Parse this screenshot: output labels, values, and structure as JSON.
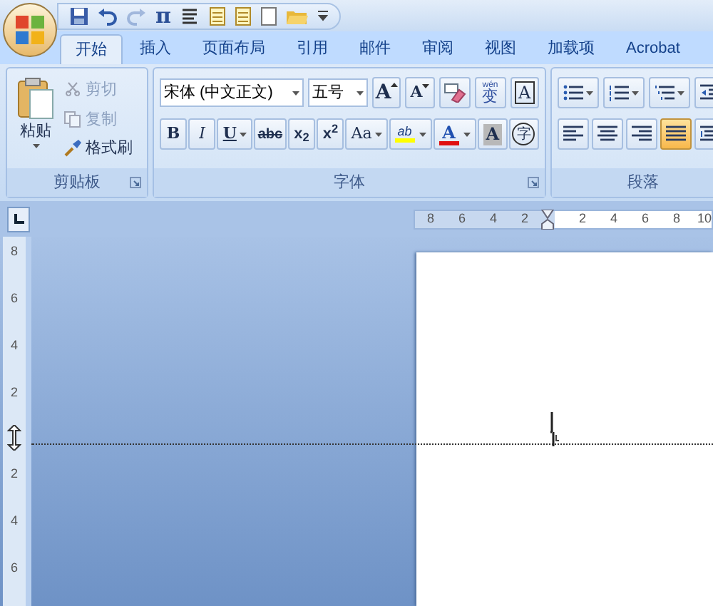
{
  "quick_access": [
    {
      "kind": "save",
      "disabled": false
    },
    {
      "kind": "undo",
      "disabled": false
    },
    {
      "kind": "redo",
      "disabled": true
    },
    {
      "kind": "equation",
      "label": "π",
      "disabled": false
    },
    {
      "kind": "list",
      "disabled": false
    },
    {
      "kind": "page",
      "disabled": false
    },
    {
      "kind": "page",
      "disabled": false
    },
    {
      "kind": "blank",
      "disabled": false
    },
    {
      "kind": "open",
      "disabled": false
    },
    {
      "kind": "customize",
      "disabled": false
    }
  ],
  "tabs": [
    {
      "label": "开始",
      "selected": true
    },
    {
      "label": "插入",
      "selected": false
    },
    {
      "label": "页面布局",
      "selected": false
    },
    {
      "label": "引用",
      "selected": false
    },
    {
      "label": "邮件",
      "selected": false
    },
    {
      "label": "审阅",
      "selected": false
    },
    {
      "label": "视图",
      "selected": false
    },
    {
      "label": "加载项",
      "selected": false
    },
    {
      "label": "Acrobat",
      "selected": false
    }
  ],
  "clipboard": {
    "title": "剪贴板",
    "paste": "粘贴",
    "items": [
      {
        "kind": "cut",
        "label": "剪切",
        "disabled": true
      },
      {
        "kind": "copy",
        "label": "复制",
        "disabled": true
      },
      {
        "kind": "painter",
        "label": "格式刷",
        "disabled": false
      }
    ]
  },
  "font": {
    "title": "字体",
    "font_name": "宋体 (中文正文)",
    "font_size": "五号",
    "row1": [
      {
        "kind": "grow",
        "label": "A"
      },
      {
        "kind": "shrink",
        "label": "A"
      },
      {
        "kind": "clear"
      },
      {
        "kind": "phonetic",
        "label": "变",
        "ruby": "wén"
      },
      {
        "kind": "border",
        "label": "A"
      }
    ],
    "row2": [
      {
        "kind": "bold",
        "label": "B"
      },
      {
        "kind": "italic",
        "label": "I"
      },
      {
        "kind": "underline",
        "label": "U"
      },
      {
        "kind": "strike",
        "label": "abc"
      },
      {
        "kind": "sub",
        "label": "x$_{2}$"
      },
      {
        "kind": "sup",
        "label": "x$^{2}$"
      },
      {
        "kind": "case",
        "label": "Aa"
      },
      {
        "kind": "highlight",
        "label": "ab",
        "color": "#ffff00"
      },
      {
        "kind": "fontcolor",
        "label": "A",
        "color": "#e01010"
      },
      {
        "kind": "shade",
        "label": "A"
      },
      {
        "kind": "enclose",
        "label": "字"
      }
    ]
  },
  "paragraph": {
    "title": "段落",
    "row1": [
      {
        "kind": "bullets"
      },
      {
        "kind": "numbering"
      },
      {
        "kind": "multilevel"
      },
      {
        "kind": "indent"
      }
    ],
    "row2": [
      {
        "kind": "align-left",
        "selected": false
      },
      {
        "kind": "center",
        "selected": false
      },
      {
        "kind": "align-right",
        "selected": false
      },
      {
        "kind": "justify",
        "selected": true
      },
      {
        "kind": "distribute",
        "selected": false
      }
    ]
  },
  "ruler": {
    "left_marks": [
      "8",
      "6",
      "4",
      "2"
    ],
    "right_marks": [
      "2",
      "4",
      "6",
      "8",
      "10"
    ]
  },
  "vertical_ruler": {
    "above": [
      "8",
      "6",
      "4",
      "2"
    ],
    "below": [
      "2",
      "4",
      "6"
    ]
  }
}
